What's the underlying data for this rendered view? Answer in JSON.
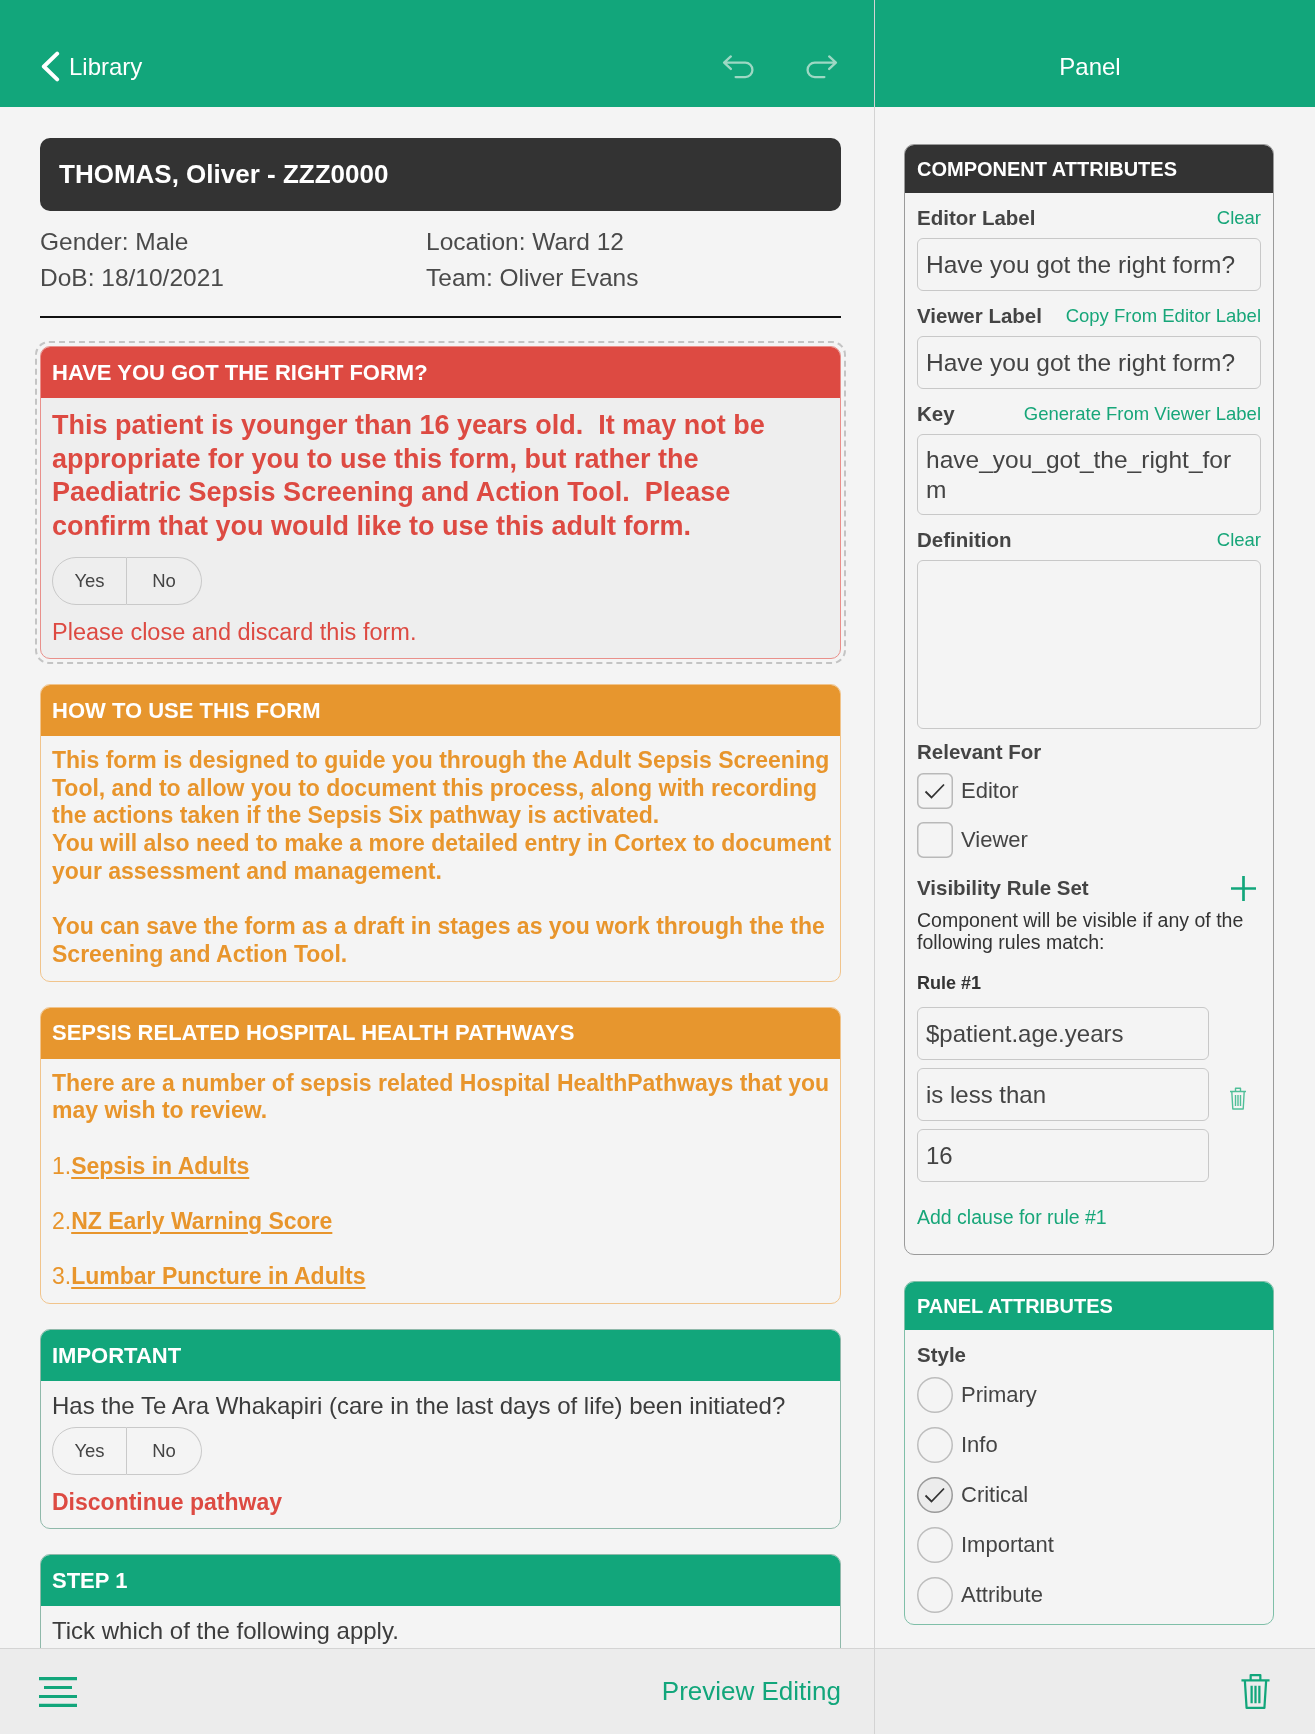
{
  "nav": {
    "back": "Library",
    "undo": {
      "disabled": true
    },
    "redo": {
      "disabled": true
    }
  },
  "patient": {
    "banner": "THOMAS, Oliver - ZZZ0000",
    "details": [
      "Gender: Male",
      "Location: Ward 12",
      "DoB: 18/10/2021",
      "Team: Oliver Evans"
    ]
  },
  "panels": [
    {
      "kind": "critical",
      "selected": true,
      "title": "HAVE YOU GOT THE RIGHT FORM?",
      "blocks": [
        {
          "kind": "lead",
          "text": "This patient is younger than 16 years old.  It may not be appropriate for you to use this form, but rather the Paediatric Sepsis Screening and Action Tool.  Please confirm that you would like to use this adult form."
        },
        {
          "kind": "choice",
          "options": [
            {
              "label": "Yes",
              "selected": false
            },
            {
              "label": "No",
              "selected": false
            }
          ]
        },
        {
          "kind": "note",
          "text": "Please close and discard this form."
        }
      ]
    },
    {
      "kind": "info",
      "selected": false,
      "title": "HOW TO USE THIS FORM",
      "blocks": [
        {
          "kind": "text",
          "parts": [
            "This form is designed to guide you through the Adult Sepsis Screening Tool, and to allow you to document this process, along with recording the actions taken if the Sepsis Six pathway is activated.",
            "You will also need to make a more detailed entry in Cortex to document your assessment and management."
          ]
        },
        {
          "kind": "text",
          "parts": [
            "You can save the form as a draft in stages as you work through the the Screening and Action Tool."
          ]
        }
      ]
    },
    {
      "kind": "info",
      "selected": false,
      "title": "SEPSIS RELATED HOSPITAL HEALTH PATHWAYS",
      "blocks": [
        {
          "kind": "text",
          "parts": [
            "There are a number of sepsis related Hospital HealthPathways that you may wish to review."
          ]
        },
        {
          "kind": "link",
          "number": "1.",
          "label": "Sepsis in Adults"
        },
        {
          "kind": "link",
          "number": "2.",
          "label": "NZ Early Warning Score"
        },
        {
          "kind": "link",
          "number": "3.",
          "label": "Lumbar Puncture in Adults"
        }
      ]
    },
    {
      "kind": "important",
      "selected": false,
      "title": "IMPORTANT",
      "blocks": [
        {
          "kind": "prompt",
          "text": "Has the Te Ara Whakapiri (care in the last days of life) been initiated?"
        },
        {
          "kind": "choice",
          "options": [
            {
              "label": "Yes",
              "selected": false
            },
            {
              "label": "No",
              "selected": false
            }
          ]
        },
        {
          "kind": "alert",
          "text": "Discontinue pathway"
        }
      ]
    },
    {
      "kind": "primary",
      "selected": false,
      "title": "STEP 1",
      "blocks": [
        {
          "kind": "prompt",
          "text": "Tick which of the following apply."
        }
      ]
    }
  ],
  "toolbar": {
    "preview": "Preview Editing"
  },
  "inspector": {
    "title": "Panel",
    "component_attributes": {
      "title": "COMPONENT ATTRIBUTES",
      "fields": [
        {
          "kind": "input",
          "label": "Editor Label",
          "action": "Clear",
          "value": "Have you got the right form?"
        },
        {
          "kind": "input",
          "label": "Viewer Label",
          "action": "Copy From Editor Label",
          "value": "Have you got the right form?"
        },
        {
          "kind": "multiline",
          "label": "Key",
          "action": "Generate From Viewer Label",
          "value": "have_you_got_the_right_form"
        },
        {
          "kind": "textarea",
          "label": "Definition",
          "action": "Clear"
        }
      ],
      "relevant_for": {
        "label": "Relevant For",
        "options": [
          {
            "label": "Editor",
            "checked": true
          },
          {
            "label": "Viewer",
            "checked": false
          }
        ]
      },
      "visibility": {
        "label": "Visibility Rule Set",
        "description": "Component will be visible if any of the following rules match:",
        "rules": [
          {
            "label": "Rule #1",
            "inputs": [
              "$patient.age.years",
              "is less than",
              "16"
            ],
            "add_clause": "Add clause for rule #1"
          }
        ]
      }
    },
    "panel_attributes": {
      "title": "PANEL ATTRIBUTES",
      "style_label": "Style",
      "styles": [
        {
          "label": "Primary",
          "selected": false
        },
        {
          "label": "Info",
          "selected": false
        },
        {
          "label": "Critical",
          "selected": true
        },
        {
          "label": "Important",
          "selected": false
        },
        {
          "label": "Attribute",
          "selected": false
        }
      ]
    }
  }
}
